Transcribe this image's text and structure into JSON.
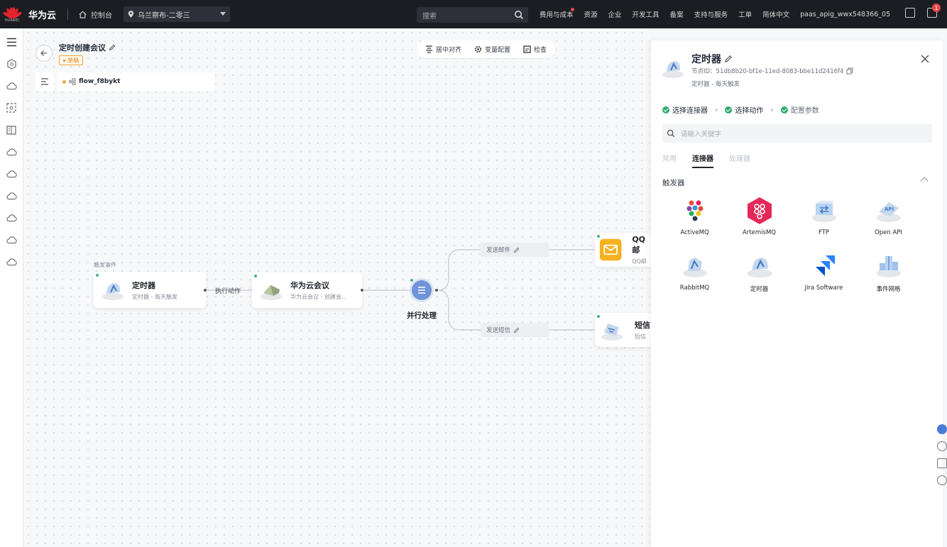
{
  "topbar": {
    "logo_caption": "HUAWEI",
    "brand": "华为云",
    "console": "控制台",
    "region": "乌兰察布-二零三",
    "search_placeholder": "搜索",
    "nav": [
      "费用与成本",
      "资源",
      "企业",
      "开发工具",
      "备案",
      "支持与服务",
      "工单",
      "简体中文",
      "paas_apig_wwx548366_05"
    ],
    "message_count": "1"
  },
  "flow": {
    "title": "定时创建会议",
    "status": "草稿",
    "name": "flow_f8bykt"
  },
  "toolbar": {
    "center": "居中对齐",
    "variables": "变量配置",
    "check": "检查"
  },
  "nodes": {
    "trigger_label": "触发事件",
    "timer": {
      "title": "定时器",
      "sub": "定时器 - 每天触发"
    },
    "execute_label": "执行动作",
    "meeting": {
      "title": "华为云会议",
      "sub": "华为云会议 - 创建会..."
    },
    "parallel": {
      "title": "并行处理"
    },
    "branch_email": "发送邮件",
    "branch_sms": "发送短信",
    "qq": {
      "title": "QQ邮",
      "sub": "QQ邮"
    },
    "sms": {
      "title": "短信",
      "sub": "短信"
    }
  },
  "panel": {
    "title": "定时器",
    "node_id": "节点ID：51db8b20-bf1e-11ed-8083-bbe11d2416f4",
    "subtitle": "定时器 - 每天触发",
    "steps": [
      "选择连接器",
      "选择动作",
      "配置参数"
    ],
    "search_placeholder": "请输入关键字",
    "tabs": [
      "常用",
      "连接器",
      "处理器"
    ],
    "active_tab": "连接器",
    "section": "触发器",
    "connectors": [
      {
        "name": "ActiveMQ",
        "icon": "activemq-icon"
      },
      {
        "name": "ArtemisMQ",
        "icon": "artemismq-icon"
      },
      {
        "name": "FTP",
        "icon": "ftp-icon"
      },
      {
        "name": "Open API",
        "icon": "openapi-icon"
      },
      {
        "name": "RabbitMQ",
        "icon": "rabbitmq-icon"
      },
      {
        "name": "定时器",
        "icon": "timer-icon"
      },
      {
        "name": "Jira Software",
        "icon": "jira-icon"
      },
      {
        "name": "事件网格",
        "icon": "eventgrid-icon"
      }
    ]
  },
  "colors": {
    "topbar": "#1b1d22",
    "accent_green": "#2eab6f",
    "draft_orange": "#e08a1e",
    "brand_red": "#e3242b"
  }
}
